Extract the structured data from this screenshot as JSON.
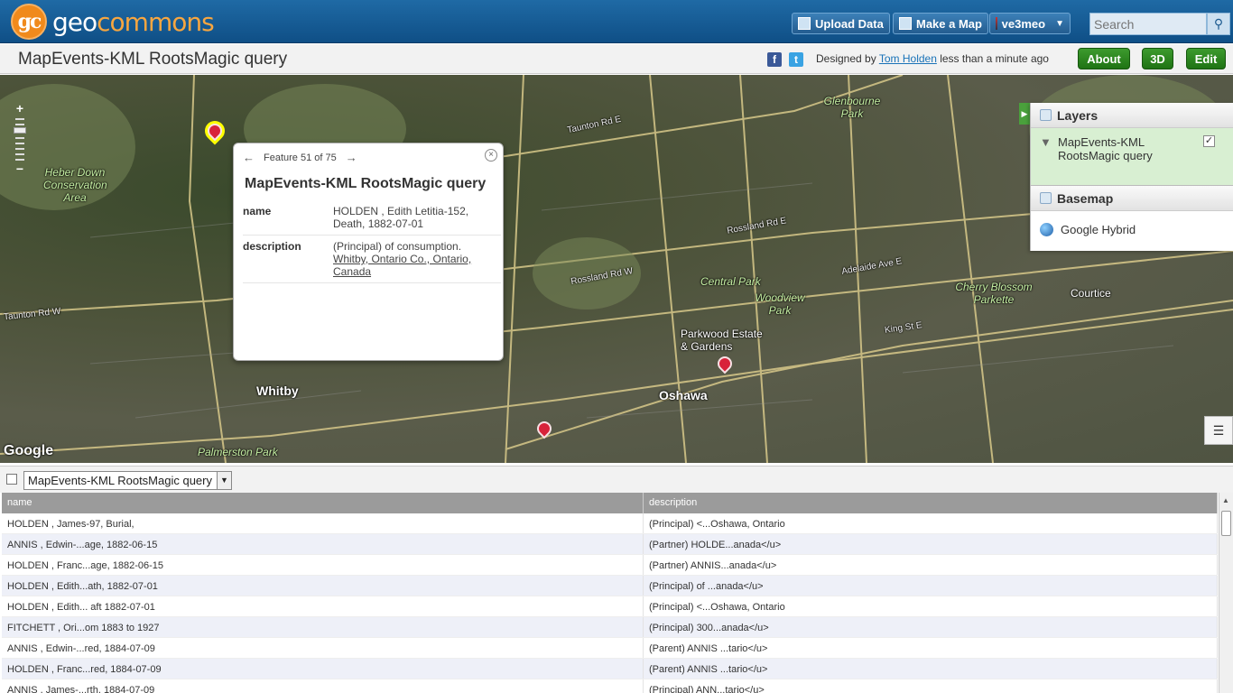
{
  "brand": {
    "mark": "gc",
    "name_a": "geo",
    "name_b": "commons"
  },
  "topnav": {
    "upload_label": "Upload Data",
    "make_map_label": "Make a Map",
    "user_label": "ve3meo",
    "search_placeholder": "Search"
  },
  "titlebar": {
    "title": "MapEvents-KML RootsMagic query",
    "designed_by_prefix": "Designed by",
    "author": "Tom Holden",
    "time_suffix": "less than a minute ago",
    "about_label": "About",
    "threed_label": "3D",
    "edit_label": "Edit"
  },
  "popup": {
    "nav_text": "Feature 51 of 75",
    "title": "MapEvents-KML RootsMagic query",
    "rows": [
      {
        "key": "name",
        "value": "HOLDEN , Edith Letitia-152, Death, 1882-07-01"
      },
      {
        "key": "description",
        "value": "(Principal) of consumption.",
        "link": "Whitby, Ontario Co., Ontario, Canada"
      }
    ]
  },
  "map_labels": {
    "heber_down": "Heber Down Conservation Area",
    "glenbourne": "Glenbourne Park",
    "central_park": "Central Park",
    "woodview": "Woodview Park",
    "cherry": "Cherry Blossom Parkette",
    "parkwood": "Parkwood Estate & Gardens",
    "whitby": "Whitby",
    "oshawa": "Oshawa",
    "palmerston": "Palmerston Park",
    "taunton": "Taunton Rd E",
    "taunton_w": "Taunton Rd W",
    "rossland_e": "Rossland Rd E",
    "rossland_w": "Rossland Rd W",
    "king_e": "King St E",
    "adelaide": "Adelaide Ave E",
    "courtice": "Courtice",
    "google": "Google"
  },
  "layers": {
    "header": "Layers",
    "layer_name": "MapEvents-KML RootsMagic query",
    "layer_checked": "✓",
    "basemap_header": "Basemap",
    "basemap_name": "Google Hybrid"
  },
  "table": {
    "selected_layer": "MapEvents-KML RootsMagic query",
    "columns": [
      "name",
      "description"
    ],
    "rows": [
      [
        "HOLDEN , James-97, Burial,",
        "(Principal) <...Oshawa, Ontario"
      ],
      [
        "ANNIS , Edwin-...age, 1882-06-15",
        "(Partner) HOLDE...anada</u>"
      ],
      [
        "HOLDEN , Franc...age, 1882-06-15",
        "(Partner) ANNIS...anada</u>"
      ],
      [
        "HOLDEN , Edith...ath, 1882-07-01",
        "(Principal) of ...anada</u>"
      ],
      [
        "HOLDEN , Edith... aft 1882-07-01",
        "(Principal) <...Oshawa, Ontario"
      ],
      [
        "FITCHETT , Ori...om 1883 to 1927",
        "(Principal) 300...anada</u>"
      ],
      [
        "ANNIS , Edwin-...red, 1884-07-09",
        "(Parent) ANNIS ...tario</u>"
      ],
      [
        "HOLDEN , Franc...red, 1884-07-09",
        "(Parent) ANNIS ...tario</u>"
      ],
      [
        "ANNIS , James-...rth, 1884-07-09",
        "(Principal) ANN...tario</u>"
      ]
    ]
  },
  "colors": {
    "topbar": "#1f6aa5",
    "accent_green": "#2f8a20",
    "pin": "#d8233a"
  }
}
